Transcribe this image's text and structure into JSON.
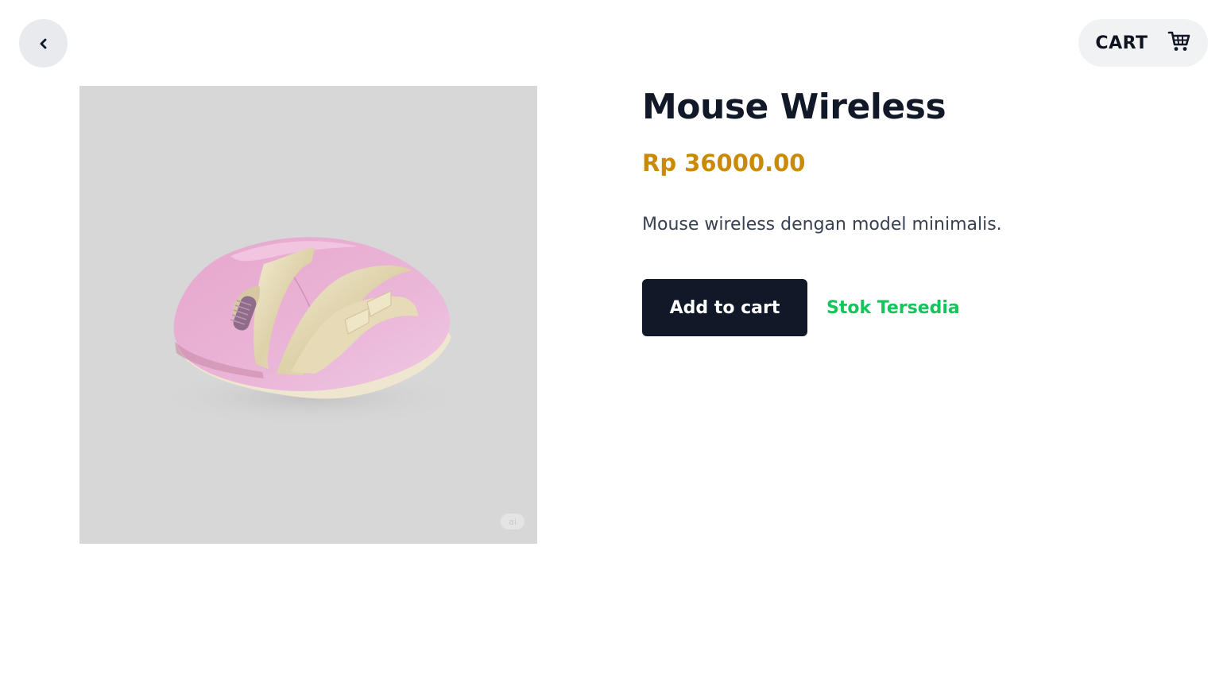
{
  "header": {
    "back_icon": "chevron-left-icon",
    "cart_label": "CART",
    "cart_icon": "shopping-cart-icon"
  },
  "product": {
    "name": "Mouse Wireless",
    "price": "Rp 36000.00",
    "description": "Mouse wireless dengan model minimalis.",
    "add_to_cart_label": "Add to cart",
    "stock_status": "Stok Tersedia",
    "image_subject": "pink-wireless-mouse"
  },
  "colors": {
    "primary_button": "#111827",
    "price": "#ca8a04",
    "stock_available": "#16c45a",
    "image_background": "#d7d7d7"
  }
}
